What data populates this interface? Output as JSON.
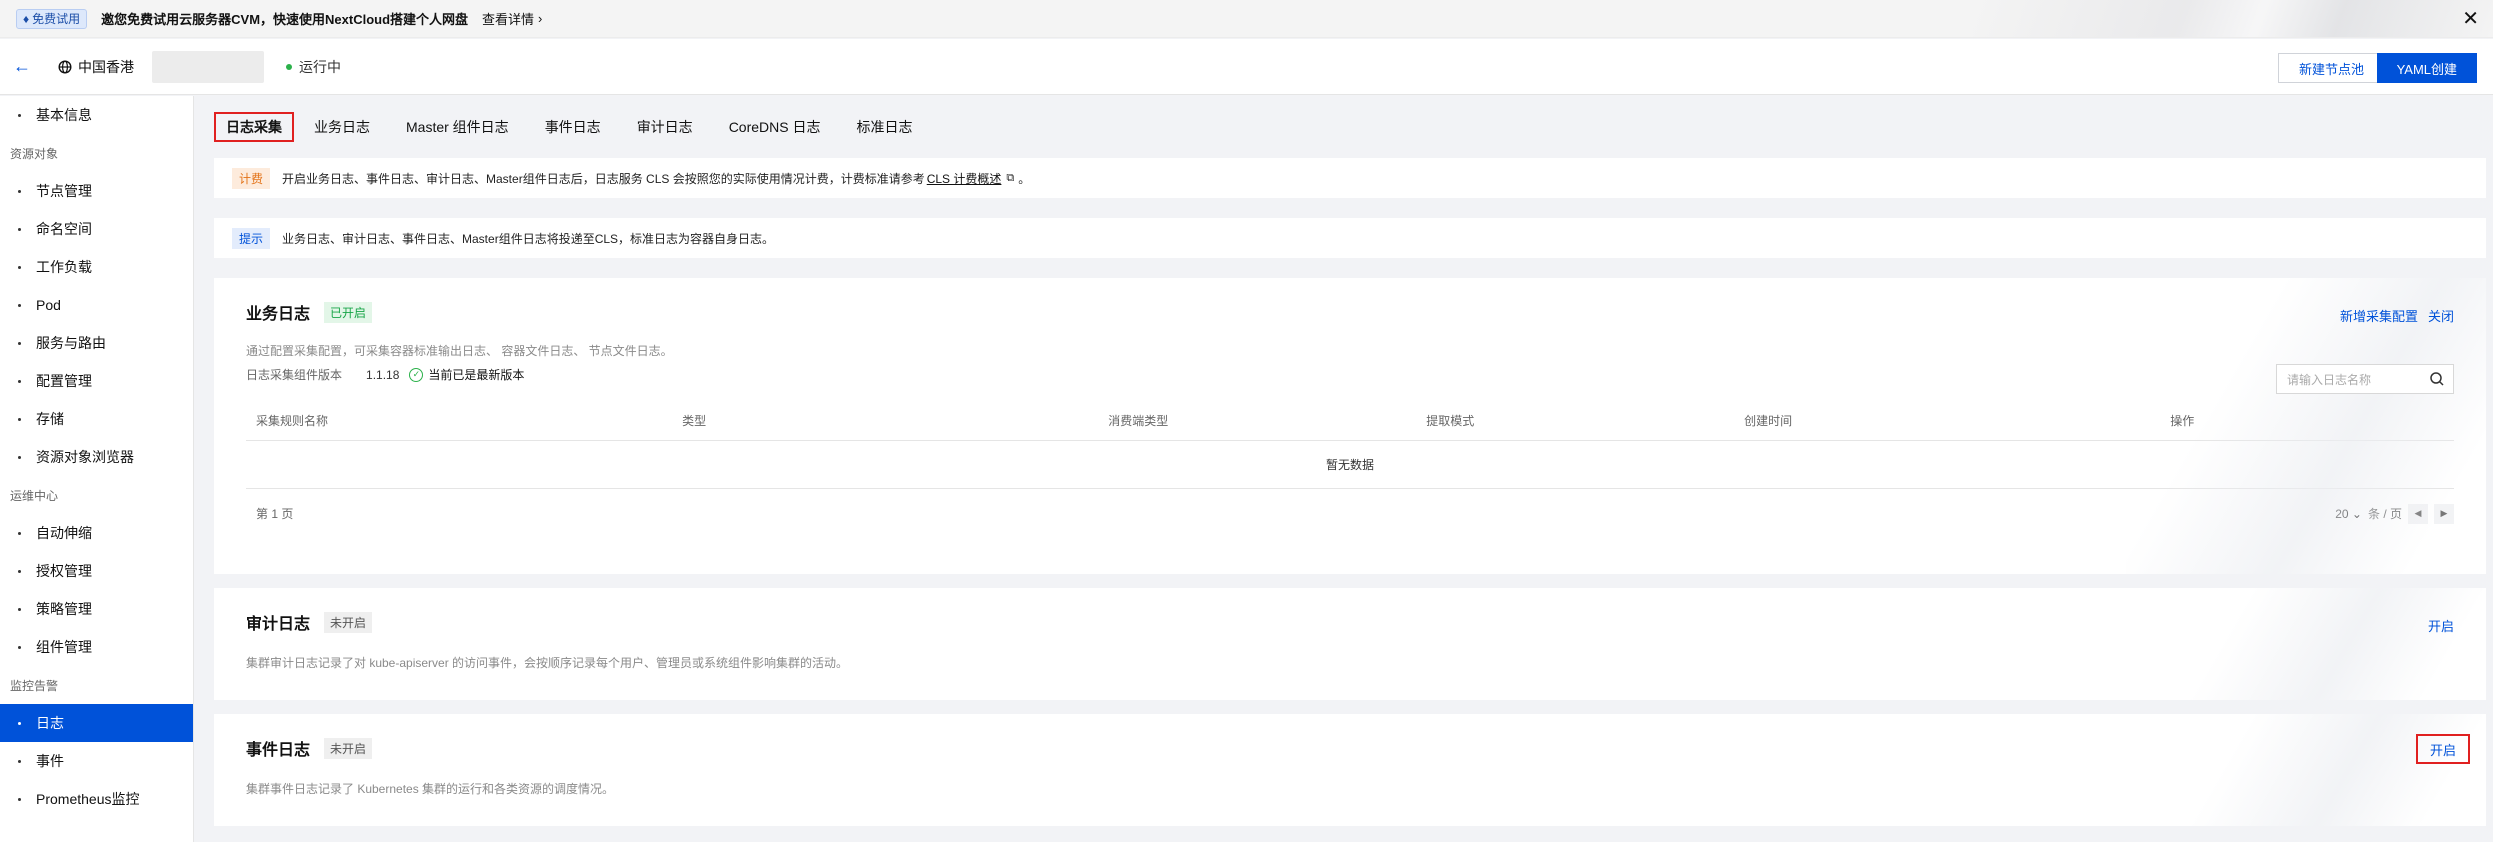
{
  "banner": {
    "badge": "免费试用",
    "text": "邀您免费试用云服务器CVM，快速使用NextCloud搭建个人网盘",
    "link": "查看详情"
  },
  "header": {
    "region": "中国香港",
    "status": "运行中",
    "btn_new_pool": "新建节点池",
    "btn_yaml": "YAML创建",
    "status_color": "#2bb14a"
  },
  "sidebar": {
    "items": [
      {
        "type": "item",
        "label": "基本信息"
      },
      {
        "type": "group",
        "label": "资源对象"
      },
      {
        "type": "item",
        "label": "节点管理"
      },
      {
        "type": "item",
        "label": "命名空间"
      },
      {
        "type": "item",
        "label": "工作负载"
      },
      {
        "type": "item",
        "label": "Pod"
      },
      {
        "type": "item",
        "label": "服务与路由"
      },
      {
        "type": "item",
        "label": "配置管理"
      },
      {
        "type": "item",
        "label": "存储"
      },
      {
        "type": "item",
        "label": "资源对象浏览器"
      },
      {
        "type": "group",
        "label": "运维中心"
      },
      {
        "type": "item",
        "label": "自动伸缩"
      },
      {
        "type": "item",
        "label": "授权管理"
      },
      {
        "type": "item",
        "label": "策略管理"
      },
      {
        "type": "item",
        "label": "组件管理"
      },
      {
        "type": "group",
        "label": "监控告警"
      },
      {
        "type": "item",
        "label": "日志",
        "active": true
      },
      {
        "type": "item",
        "label": "事件"
      },
      {
        "type": "item",
        "label": "Prometheus监控"
      }
    ]
  },
  "tabs": [
    "日志采集",
    "业务日志",
    "Master 组件日志",
    "事件日志",
    "审计日志",
    "CoreDNS 日志",
    "标准日志"
  ],
  "billing_notice": {
    "tag": "计费",
    "text": "开启业务日志、事件日志、审计日志、Master组件日志后，日志服务 CLS 会按照您的实际使用情况计费，计费标准请参考",
    "link": "CLS 计费概述",
    "suffix": "。"
  },
  "hint_notice": {
    "tag": "提示",
    "text": "业务日志、审计日志、事件日志、Master组件日志将投递至CLS，标准日志为容器自身日志。"
  },
  "business_log": {
    "title": "业务日志",
    "badge": "已开启",
    "action_new": "新增采集配置",
    "action_close": "关闭",
    "desc": "通过配置采集配置，可采集容器标准输出日志、 容器文件日志、 节点文件日志。",
    "version_label": "日志采集组件版本",
    "version": "1.1.18",
    "latest": "当前已是最新版本",
    "search_placeholder": "请输入日志名称",
    "columns": [
      "采集规则名称",
      "类型",
      "消费端类型",
      "提取模式",
      "创建时间",
      "操作"
    ],
    "empty": "暂无数据",
    "page": "第 1 页",
    "page_size": "20",
    "per_page": "条 / 页"
  },
  "audit_log": {
    "title": "审计日志",
    "badge": "未开启",
    "action": "开启",
    "desc": "集群审计日志记录了对 kube-apiserver 的访问事件，会按顺序记录每个用户、管理员或系统组件影响集群的活动。"
  },
  "event_log": {
    "title": "事件日志",
    "badge": "未开启",
    "action": "开启",
    "desc": "集群事件日志记录了 Kubernetes 集群的运行和各类资源的调度情况。"
  }
}
